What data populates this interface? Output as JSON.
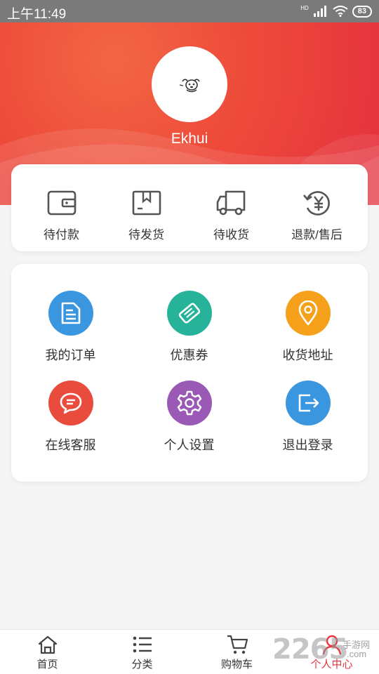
{
  "status_bar": {
    "time": "上午11:49",
    "network": "HD",
    "battery": "83"
  },
  "profile": {
    "username": "Ekhui"
  },
  "orders": [
    {
      "label": "待付款",
      "icon": "wallet-icon"
    },
    {
      "label": "待发货",
      "icon": "package-icon"
    },
    {
      "label": "待收货",
      "icon": "truck-icon"
    },
    {
      "label": "退款/售后",
      "icon": "refund-yen-icon"
    }
  ],
  "menu": [
    {
      "label": "我的订单",
      "icon": "document-icon",
      "color": "#3b96e0"
    },
    {
      "label": "优惠券",
      "icon": "ticket-icon",
      "color": "#27b29a"
    },
    {
      "label": "收货地址",
      "icon": "location-pin-icon",
      "color": "#f5a11b"
    },
    {
      "label": "在线客服",
      "icon": "chat-bubble-icon",
      "color": "#e94b3c"
    },
    {
      "label": "个人设置",
      "icon": "gear-icon",
      "color": "#9b59b6"
    },
    {
      "label": "退出登录",
      "icon": "logout-icon",
      "color": "#3b96e0"
    }
  ],
  "tabs": [
    {
      "label": "首页",
      "icon": "home-icon"
    },
    {
      "label": "分类",
      "icon": "list-icon"
    },
    {
      "label": "购物车",
      "icon": "cart-icon"
    },
    {
      "label": "个人中心",
      "icon": "user-icon",
      "active": true
    }
  ],
  "watermark": {
    "number": "2265",
    "brand": "手游网",
    "domain": ".com"
  },
  "colors": {
    "accent": "#e8343f",
    "hero_start": "#f26644",
    "hero_end": "#e4303f"
  }
}
